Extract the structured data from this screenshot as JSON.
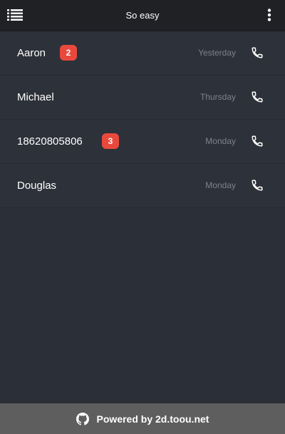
{
  "header": {
    "title": "So easy",
    "menu_icon": "list-icon",
    "more_icon": "more-vertical-icon"
  },
  "contacts": [
    {
      "name": "Aaron",
      "badge": "2",
      "time": "Yesterday"
    },
    {
      "name": "Michael",
      "badge": "",
      "time": "Thursday"
    },
    {
      "name": "18620805806",
      "badge": "3",
      "time": "Monday"
    },
    {
      "name": "Douglas",
      "badge": "",
      "time": "Monday"
    }
  ],
  "footer": {
    "text": "Powered by 2d.toou.net",
    "icon": "github-icon"
  },
  "colors": {
    "header_bg": "#1f2125",
    "list_bg": "#2d3139",
    "badge": "#e9493d",
    "footer_bg": "#5e5e5e"
  }
}
